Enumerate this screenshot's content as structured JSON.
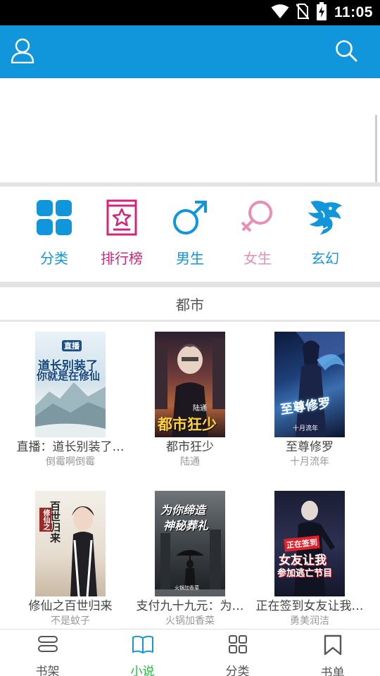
{
  "status_bar": {
    "time": "11:05"
  },
  "app_bar": {
    "color": "#1296db",
    "left_icon": "user-icon",
    "right_icon": "search-icon"
  },
  "categories": [
    {
      "label": "分类",
      "icon": "grid-icon",
      "color": "#1296db"
    },
    {
      "label": "排行榜",
      "icon": "ranking-icon",
      "color": "#d4237a"
    },
    {
      "label": "男生",
      "icon": "male-icon",
      "color": "#1296db"
    },
    {
      "label": "女生",
      "icon": "female-icon",
      "color": "#e98fb5"
    },
    {
      "label": "玄幻",
      "icon": "dragon-icon",
      "color": "#1296db"
    }
  ],
  "section": {
    "title": "都市"
  },
  "books": [
    {
      "title": "直播：道长别装了…",
      "author": "倒霉啊倒霉"
    },
    {
      "title": "都市狂少",
      "author": "陆通"
    },
    {
      "title": "至尊修罗",
      "author": "十月流年"
    },
    {
      "title": "修仙之百世归来",
      "author": "不是蚊子"
    },
    {
      "title": "支付九十九元：为…",
      "author": "火锅加香菜"
    },
    {
      "title": "正在签到女友让我…",
      "author": "勇美润洁"
    }
  ],
  "covers": [
    {
      "lines": [
        "直播",
        "道长别装了",
        "你就是在修仙"
      ]
    },
    {
      "lines": [
        "都市狂少",
        "陆通"
      ]
    },
    {
      "lines": [
        "至尊修罗",
        "十月流年"
      ]
    },
    {
      "lines": [
        "百世归来",
        "修仙之"
      ]
    },
    {
      "lines": [
        "为你缔造",
        "神秘葬礼",
        "火锅加香菜"
      ]
    },
    {
      "lines": [
        "正在签到",
        "女友让我",
        "参加逃亡节目"
      ]
    }
  ],
  "bottom_nav": [
    {
      "label": "书架",
      "icon": "bookshelf-icon",
      "active": false
    },
    {
      "label": "小说",
      "icon": "book-open-icon",
      "active": true
    },
    {
      "label": "分类",
      "icon": "grid-outline-icon",
      "active": false
    },
    {
      "label": "书单",
      "icon": "bookmark-icon",
      "active": false
    }
  ],
  "colors": {
    "accent": "#1296db",
    "active_nav": "#1bbd3a"
  }
}
